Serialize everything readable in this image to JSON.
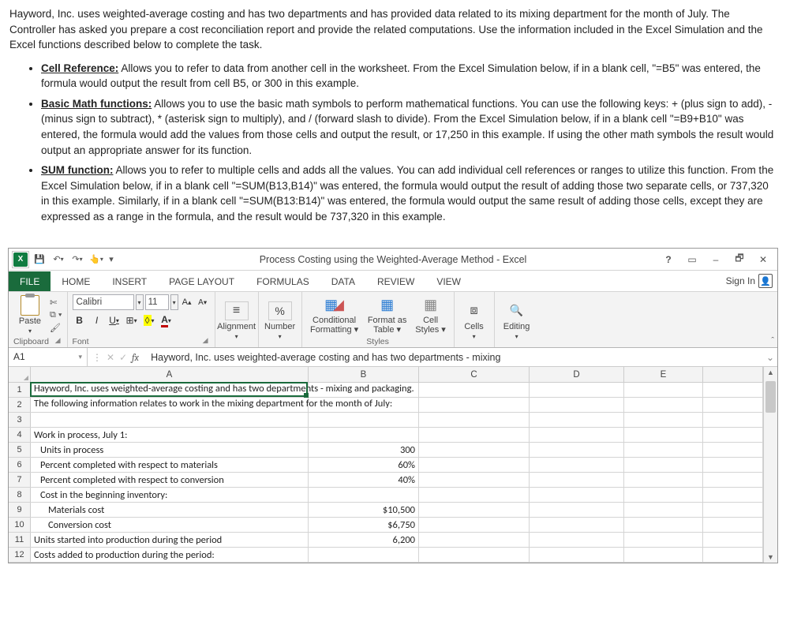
{
  "instructions": {
    "intro": "Hayword, Inc. uses weighted-average costing and has two departments and has provided data related to its mixing department for the month of July.  The Controller has asked you prepare a cost reconciliation report and provide the related computations.  Use the information included in the Excel Simulation and the Excel functions described below to complete the task.",
    "bullets": [
      {
        "title": "Cell Reference:",
        "body": "Allows you to refer to data from another cell in the worksheet.  From the Excel Simulation below, if in a blank cell, \"=B5\" was entered, the formula would output the result from cell B5, or 300 in this example."
      },
      {
        "title": "Basic Math functions:",
        "body": "Allows you to use the basic math symbols to perform mathematical functions.  You can use the following keys:  + (plus sign to add), - (minus sign to subtract), * (asterisk sign to multiply), and / (forward slash to divide).  From the Excel Simulation below, if in a blank cell \"=B9+B10\" was entered, the formula would add the values from those cells and output the result, or 17,250 in this example.  If using the other math symbols the result would output an appropriate answer for its function."
      },
      {
        "title": "SUM function:",
        "body": "Allows you to refer to multiple cells and adds all the values.  You can add individual cell references or ranges to utilize this function.  From the Excel Simulation below, if in a blank cell \"=SUM(B13,B14)\" was entered, the formula would output the result of adding those two separate cells, or 737,320 in this example.  Similarly, if in a blank cell \"=SUM(B13:B14)\" was entered, the formula would output the same result of adding those cells, except they are expressed as a range in the formula, and the result would be 737,320 in this example."
      }
    ]
  },
  "window": {
    "title": "Process Costing using the Weighted-Average Method - Excel",
    "help": "?",
    "ribbon_opts": "▭",
    "min": "–",
    "restore": "🗗",
    "close": "✕"
  },
  "qat": {
    "save": "💾",
    "undo": "↶",
    "redo": "↷"
  },
  "tabs": {
    "file": "FILE",
    "home": "HOME",
    "insert": "INSERT",
    "page_layout": "PAGE LAYOUT",
    "formulas": "FORMULAS",
    "data": "DATA",
    "review": "REVIEW",
    "view": "VIEW",
    "sign_in": "Sign In"
  },
  "ribbon": {
    "clipboard": {
      "paste": "Paste",
      "label": "Clipboard",
      "cut": "✄",
      "copy": "⧉",
      "format_painter": "🖌"
    },
    "font": {
      "name": "Calibri",
      "size": "11",
      "increase": "A▴",
      "decrease": "A▾",
      "bold": "B",
      "italic": "I",
      "underline": "U",
      "border": "⊞",
      "fill": "◊",
      "color": "A",
      "label": "Font"
    },
    "alignment": {
      "label": "Alignment",
      "icon": "≡",
      "wrap": "⇥"
    },
    "number": {
      "label": "Number",
      "icon": "%",
      "general": "⯆"
    },
    "styles": {
      "conditional": "Conditional Formatting ▾",
      "format_as": "Format as Table ▾",
      "cell_styles": "Cell Styles ▾",
      "label": "Styles",
      "cf_icon": "▦",
      "tbl_icon": "▦",
      "cs_icon": "▦"
    },
    "cells": {
      "label": "Cells",
      "icon": "⧈"
    },
    "editing": {
      "label": "Editing",
      "icon": "🔍"
    }
  },
  "formula_bar": {
    "name_box": "A1",
    "fx": "fx",
    "formula": "Hayword, Inc. uses weighted-average costing and has two departments - mixing"
  },
  "columns": {
    "A": "A",
    "B": "B",
    "C": "C",
    "D": "D",
    "E": "E"
  },
  "chart_data": {
    "type": "table",
    "rows": [
      {
        "n": 1,
        "a": "Hayword, Inc. uses weighted-average costing and has two departments - mixing and packaging.",
        "b": ""
      },
      {
        "n": 2,
        "a": "The following information relates to work in the mixing department for the month of July:",
        "b": ""
      },
      {
        "n": 3,
        "a": "",
        "b": ""
      },
      {
        "n": 4,
        "a": "Work in process, July 1:",
        "b": ""
      },
      {
        "n": 5,
        "a": "Units in process",
        "b": "300",
        "indent": 1
      },
      {
        "n": 6,
        "a": "Percent completed with respect to materials",
        "b": "60%",
        "indent": 1
      },
      {
        "n": 7,
        "a": "Percent completed with respect to conversion",
        "b": "40%",
        "indent": 1
      },
      {
        "n": 8,
        "a": "Cost in the beginning inventory:",
        "b": "",
        "indent": 1
      },
      {
        "n": 9,
        "a": "Materials cost",
        "b": "$10,500",
        "indent": 2
      },
      {
        "n": 10,
        "a": "Conversion cost",
        "b": "$6,750",
        "indent": 2
      },
      {
        "n": 11,
        "a": "Units started into production during the period",
        "b": "6,200"
      },
      {
        "n": 12,
        "a": "Costs added to production during the period:",
        "b": ""
      }
    ]
  }
}
